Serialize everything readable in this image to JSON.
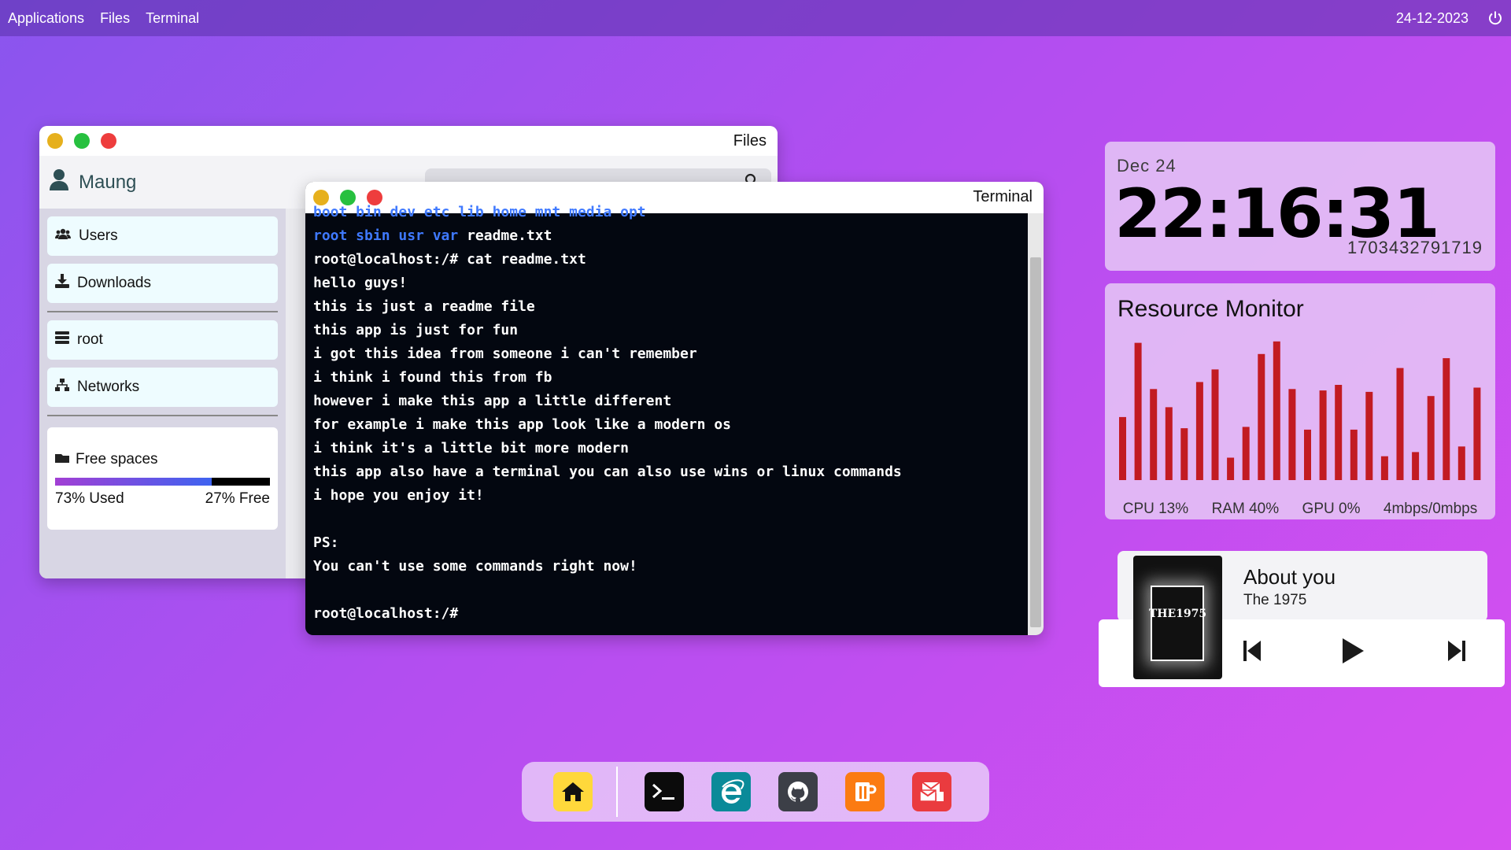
{
  "topbar": {
    "menu": [
      "Applications",
      "Files",
      "Terminal"
    ],
    "date": "24-12-2023"
  },
  "files_window": {
    "title": "Files",
    "user": "Maung",
    "sidebar": [
      {
        "label": "Users",
        "icon": "users-icon"
      },
      {
        "label": "Downloads",
        "icon": "download-icon"
      },
      {
        "label": "root",
        "icon": "server-icon"
      },
      {
        "label": "Networks",
        "icon": "network-icon"
      }
    ],
    "storage": {
      "label": "Free spaces",
      "used_fraction": 0.73,
      "used_text": "73% Used",
      "free_text": "27% Free"
    }
  },
  "terminal_window": {
    "title": "Terminal",
    "lines": [
      {
        "t": "boot bin dev etc lib home mnt media opt",
        "c": "dir"
      },
      {
        "t": "root sbin usr var",
        "c": "dir",
        "suffix": " readme.txt"
      },
      {
        "t": "root@localhost:/# cat readme.txt"
      },
      {
        "t": "hello guys!"
      },
      {
        "t": "this is just a readme file"
      },
      {
        "t": "this app is just for fun"
      },
      {
        "t": "i got this idea from someone i can't remember"
      },
      {
        "t": "i think i found this from fb"
      },
      {
        "t": "however i make this app a little different"
      },
      {
        "t": "for example i make this app look like a modern os"
      },
      {
        "t": "i think it's a little bit more modern"
      },
      {
        "t": "this app also have a terminal you can also use wins or linux commands"
      },
      {
        "t": "i hope you enjoy it!"
      },
      {
        "t": ""
      },
      {
        "t": "PS:"
      },
      {
        "t": "You can't use some commands right now!"
      },
      {
        "t": ""
      },
      {
        "t": "root@localhost:/#"
      }
    ]
  },
  "clock": {
    "date": "Dec 24",
    "time": "22:16:31",
    "epoch": "1703432791719"
  },
  "resource_monitor": {
    "title": "Resource Monitor",
    "labels": [
      "CPU 13%",
      "RAM 40%",
      "GPU 0%",
      "4mbps/0mbps"
    ],
    "bar_color": "#c21b22",
    "bars": [
      0.45,
      0.98,
      0.65,
      0.52,
      0.37,
      0.7,
      0.79,
      0.16,
      0.38,
      0.9,
      0.99,
      0.65,
      0.36,
      0.64,
      0.68,
      0.36,
      0.63,
      0.17,
      0.8,
      0.2,
      0.6,
      0.87,
      0.24,
      0.66
    ]
  },
  "music": {
    "song": "About you",
    "artist": "The 1975",
    "album_text": "THE1975"
  },
  "dock": [
    "home-icon",
    "terminal-icon",
    "browser-icon",
    "github-icon",
    "coffee-icon",
    "mail-icon"
  ]
}
